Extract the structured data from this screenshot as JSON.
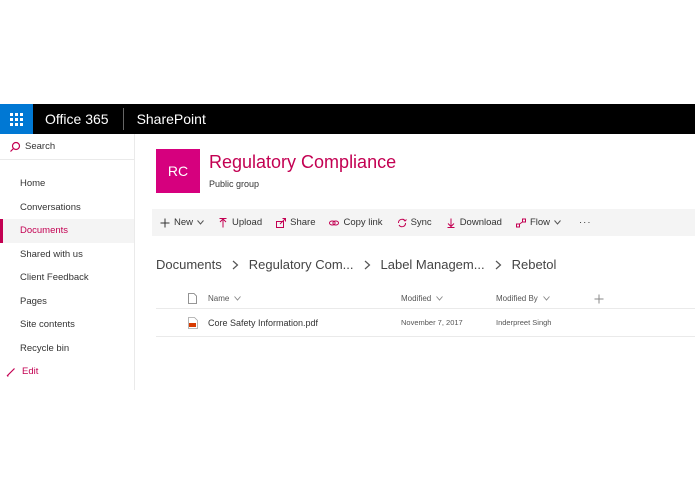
{
  "suite": {
    "brand": "Office 365",
    "app": "SharePoint",
    "accent": "#0078d4"
  },
  "nav": {
    "search_label": "Search",
    "items": [
      {
        "label": "Home"
      },
      {
        "label": "Conversations"
      },
      {
        "label": "Documents"
      },
      {
        "label": "Shared with us"
      },
      {
        "label": "Client Feedback"
      },
      {
        "label": "Pages"
      },
      {
        "label": "Site contents"
      },
      {
        "label": "Recycle bin"
      }
    ],
    "active_index": 2,
    "edit_label": "Edit"
  },
  "site": {
    "logo_initials": "RC",
    "title": "Regulatory Compliance",
    "subtitle": "Public group",
    "brand_color": "#c30052"
  },
  "commands": {
    "new": "New",
    "upload": "Upload",
    "share": "Share",
    "copy_link": "Copy link",
    "sync": "Sync",
    "download": "Download",
    "flow": "Flow",
    "more": "···"
  },
  "breadcrumb": [
    "Documents",
    "Regulatory Com...",
    "Label Managem...",
    "Rebetol"
  ],
  "table": {
    "headers": {
      "name": "Name",
      "modified": "Modified",
      "modified_by": "Modified By"
    },
    "rows": [
      {
        "name": "Core Safety Information.pdf",
        "modified": "November 7, 2017",
        "modified_by": "Inderpreet Singh",
        "icon": "pdf-file-icon"
      }
    ]
  }
}
